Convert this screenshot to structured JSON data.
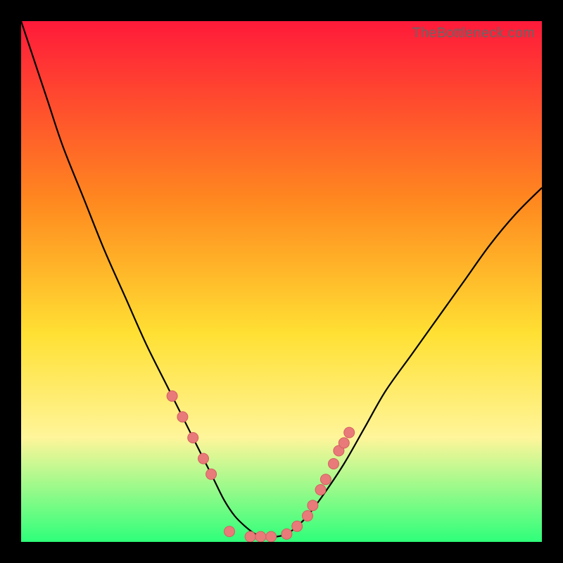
{
  "watermark": "TheBottleneck.com",
  "colors": {
    "frame": "#000000",
    "gradient_top": "#ff1a3a",
    "gradient_mid1": "#ff8a1f",
    "gradient_mid2": "#ffe033",
    "gradient_mid3": "#fff59a",
    "gradient_bottom": "#2eff7a",
    "curve": "#000000",
    "marker_fill": "#e87a7a",
    "marker_stroke": "#d46060"
  },
  "chart_data": {
    "type": "line",
    "title": "",
    "xlabel": "",
    "ylabel": "",
    "xlim": [
      0,
      100
    ],
    "ylim": [
      0,
      100
    ],
    "series": [
      {
        "name": "bottleneck-curve",
        "x": [
          0,
          2,
          5,
          8,
          12,
          16,
          20,
          24,
          28,
          31,
          33,
          35,
          37,
          39,
          41,
          43,
          45,
          47,
          49,
          51,
          53,
          55,
          58,
          62,
          66,
          70,
          75,
          80,
          85,
          90,
          95,
          100
        ],
        "y": [
          100,
          94,
          85,
          76,
          66,
          56,
          47,
          38,
          30,
          24,
          20,
          16,
          12,
          8,
          5,
          3,
          1.5,
          1,
          1,
          1.5,
          3,
          5,
          9,
          15,
          22,
          29,
          36,
          43,
          50,
          57,
          63,
          68
        ]
      }
    ],
    "markers": {
      "name": "sample-points",
      "x": [
        29,
        31,
        33,
        35,
        36.5,
        40,
        44,
        46,
        48,
        51,
        53,
        55,
        56,
        57.5,
        58.5,
        60,
        61,
        62,
        63
      ],
      "y": [
        28,
        24,
        20,
        16,
        13,
        2,
        1,
        1,
        1,
        1.5,
        3,
        5,
        7,
        10,
        12,
        15,
        17.5,
        19,
        21
      ]
    }
  }
}
